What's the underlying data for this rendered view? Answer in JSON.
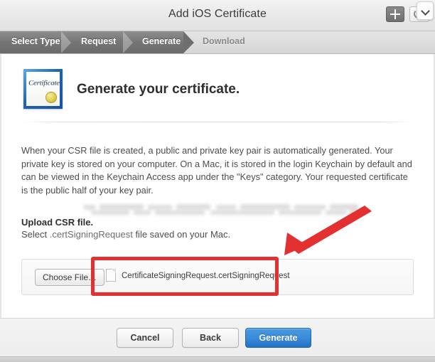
{
  "window": {
    "title": "Add iOS Certificate",
    "toolbar": {
      "add_icon": "plus-icon",
      "refresh_icon": "refresh-icon",
      "chevron_icon": "chevron-down-icon"
    }
  },
  "steps": {
    "items": [
      {
        "label": "Select Type",
        "state": "done"
      },
      {
        "label": "Request",
        "state": "done"
      },
      {
        "label": "Generate",
        "state": "active"
      },
      {
        "label": "Download",
        "state": "upcoming"
      }
    ]
  },
  "content": {
    "icon_name": "certificate-icon",
    "icon_caption": "Certificate",
    "headline": "Generate your certificate.",
    "paragraph": "When your CSR file is created, a public and private key pair is automatically generated. Your private key is stored on your computer. On a Mac, it is stored in the login Keychain by default and can be viewed in the Keychain Access app under the \"Keys\" category. Your requested certificate is the public half of your key pair.",
    "upload_title": "Upload CSR file.",
    "upload_sub_prefix": "Select ",
    "upload_sub_mono": ".certSigningRequest",
    "upload_sub_suffix": " file saved on your Mac.",
    "choose_file_label": "Choose File…",
    "file_icon_name": "document-icon",
    "file_name": "CertificateSigningRequest.certSigningRequest"
  },
  "footer": {
    "cancel_label": "Cancel",
    "back_label": "Back",
    "generate_label": "Generate"
  },
  "annotations": {
    "color": "#e33030",
    "arrow_name": "red-arrow-annotation",
    "file_box_name": "red-box-file-row",
    "generate_box_name": "red-box-generate-button"
  },
  "colors": {
    "accent_blue": "#3b8ddd",
    "step_active": "#6e6e6e",
    "annotation_red": "#e33030",
    "titlebar": "#e8e8e8"
  }
}
